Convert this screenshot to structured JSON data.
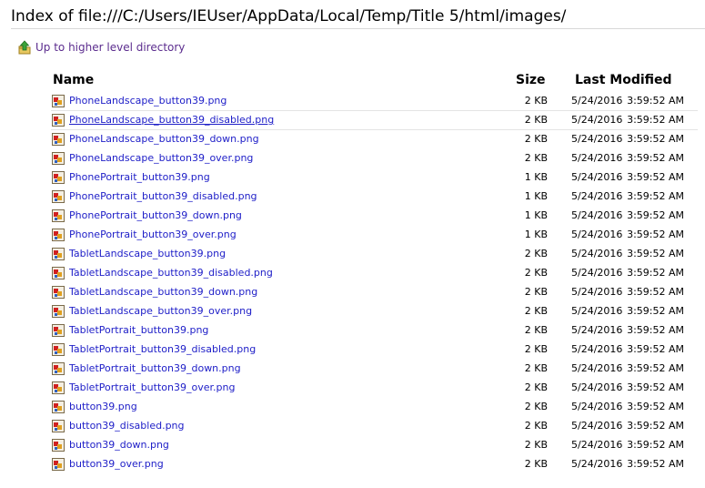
{
  "page": {
    "title": "Index of file:///C:/Users/IEUser/AppData/Local/Temp/Title 5/html/images/",
    "up_link_label": "Up to higher level directory"
  },
  "columns": {
    "name": "Name",
    "size": "Size",
    "modified": "Last Modified"
  },
  "icons": {
    "up": "up-arrow-folder-icon",
    "file": "image-file-icon"
  },
  "colors": {
    "link": "#2020c8",
    "visited_link": "#5b2c8e"
  },
  "files": [
    {
      "name": "PhoneLandscape_button39.png",
      "size": "2 KB",
      "date": "5/24/2016",
      "time": "3:59:52 AM"
    },
    {
      "name": "PhoneLandscape_button39_disabled.png",
      "size": "2 KB",
      "date": "5/24/2016",
      "time": "3:59:52 AM"
    },
    {
      "name": "PhoneLandscape_button39_down.png",
      "size": "2 KB",
      "date": "5/24/2016",
      "time": "3:59:52 AM"
    },
    {
      "name": "PhoneLandscape_button39_over.png",
      "size": "2 KB",
      "date": "5/24/2016",
      "time": "3:59:52 AM"
    },
    {
      "name": "PhonePortrait_button39.png",
      "size": "1 KB",
      "date": "5/24/2016",
      "time": "3:59:52 AM"
    },
    {
      "name": "PhonePortrait_button39_disabled.png",
      "size": "1 KB",
      "date": "5/24/2016",
      "time": "3:59:52 AM"
    },
    {
      "name": "PhonePortrait_button39_down.png",
      "size": "1 KB",
      "date": "5/24/2016",
      "time": "3:59:52 AM"
    },
    {
      "name": "PhonePortrait_button39_over.png",
      "size": "1 KB",
      "date": "5/24/2016",
      "time": "3:59:52 AM"
    },
    {
      "name": "TabletLandscape_button39.png",
      "size": "2 KB",
      "date": "5/24/2016",
      "time": "3:59:52 AM"
    },
    {
      "name": "TabletLandscape_button39_disabled.png",
      "size": "2 KB",
      "date": "5/24/2016",
      "time": "3:59:52 AM"
    },
    {
      "name": "TabletLandscape_button39_down.png",
      "size": "2 KB",
      "date": "5/24/2016",
      "time": "3:59:52 AM"
    },
    {
      "name": "TabletLandscape_button39_over.png",
      "size": "2 KB",
      "date": "5/24/2016",
      "time": "3:59:52 AM"
    },
    {
      "name": "TabletPortrait_button39.png",
      "size": "2 KB",
      "date": "5/24/2016",
      "time": "3:59:52 AM"
    },
    {
      "name": "TabletPortrait_button39_disabled.png",
      "size": "2 KB",
      "date": "5/24/2016",
      "time": "3:59:52 AM"
    },
    {
      "name": "TabletPortrait_button39_down.png",
      "size": "2 KB",
      "date": "5/24/2016",
      "time": "3:59:52 AM"
    },
    {
      "name": "TabletPortrait_button39_over.png",
      "size": "2 KB",
      "date": "5/24/2016",
      "time": "3:59:52 AM"
    },
    {
      "name": "button39.png",
      "size": "2 KB",
      "date": "5/24/2016",
      "time": "3:59:52 AM"
    },
    {
      "name": "button39_disabled.png",
      "size": "2 KB",
      "date": "5/24/2016",
      "time": "3:59:52 AM"
    },
    {
      "name": "button39_down.png",
      "size": "2 KB",
      "date": "5/24/2016",
      "time": "3:59:52 AM"
    },
    {
      "name": "button39_over.png",
      "size": "2 KB",
      "date": "5/24/2016",
      "time": "3:59:52 AM"
    }
  ]
}
